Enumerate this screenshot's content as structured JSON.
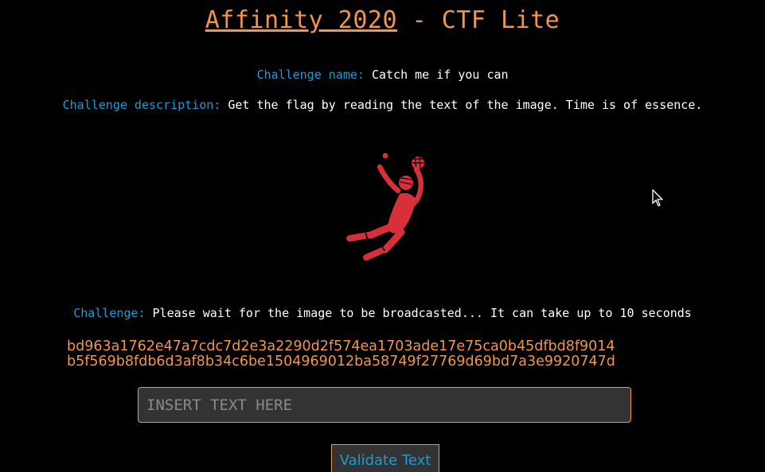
{
  "header": {
    "title_link": "Affinity 2020",
    "title_suffix": " - CTF Lite"
  },
  "challenge_name": {
    "label": "Challenge name:",
    "value": "Catch me if you can"
  },
  "challenge_description": {
    "label": "Challenge description:",
    "value": "Get the flag by reading the text of the image. Time is of essence."
  },
  "challenge": {
    "label": "Challenge:",
    "value": "Please wait for the image to be broadcasted... It can take up to 10 seconds"
  },
  "hash_lines": [
    "bd963a1762e47a7cdc7d2e3a2290d2f574ea1703ade17e75ca0b45dfbd8f9014",
    "b5f569b8fdb6d3af8b34c6be1504969012ba58749f27769d69bd7a3e9920747d"
  ],
  "form": {
    "input_placeholder": "INSERT TEXT HERE",
    "input_value": "",
    "submit_label": "Validate Text"
  },
  "icons": {
    "figure": "goalkeeper-catch-icon",
    "cursor": "mouse-pointer-icon"
  },
  "colors": {
    "background": "#000000",
    "accent_orange": "#f0954a",
    "label_blue": "#1e9ad6",
    "figure_red": "#d7303a",
    "text_white": "#ffffff",
    "field_bg": "#333333"
  }
}
